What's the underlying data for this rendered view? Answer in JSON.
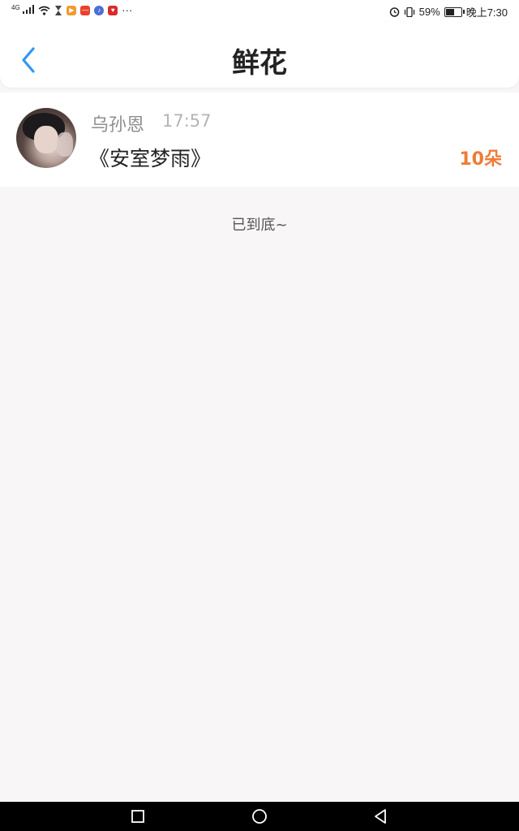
{
  "status_bar": {
    "signal_label": "4G",
    "more": "···",
    "battery_percent_text": "59%",
    "battery_level": 0.59,
    "time": "晚上7:30"
  },
  "header": {
    "title": "鲜花"
  },
  "records": [
    {
      "sender": "乌孙恩",
      "time": "17:57",
      "work": "《安室梦雨》",
      "count": "10朵"
    }
  ],
  "end_note": "已到底~",
  "colors": {
    "accent": "#2f98f0",
    "count": "#ef7c34",
    "background": "#f8f6f7"
  },
  "icons": {
    "back": "chevron-left-icon",
    "nav_recent": "square-icon",
    "nav_home": "circle-icon",
    "nav_back": "triangle-left-icon"
  }
}
